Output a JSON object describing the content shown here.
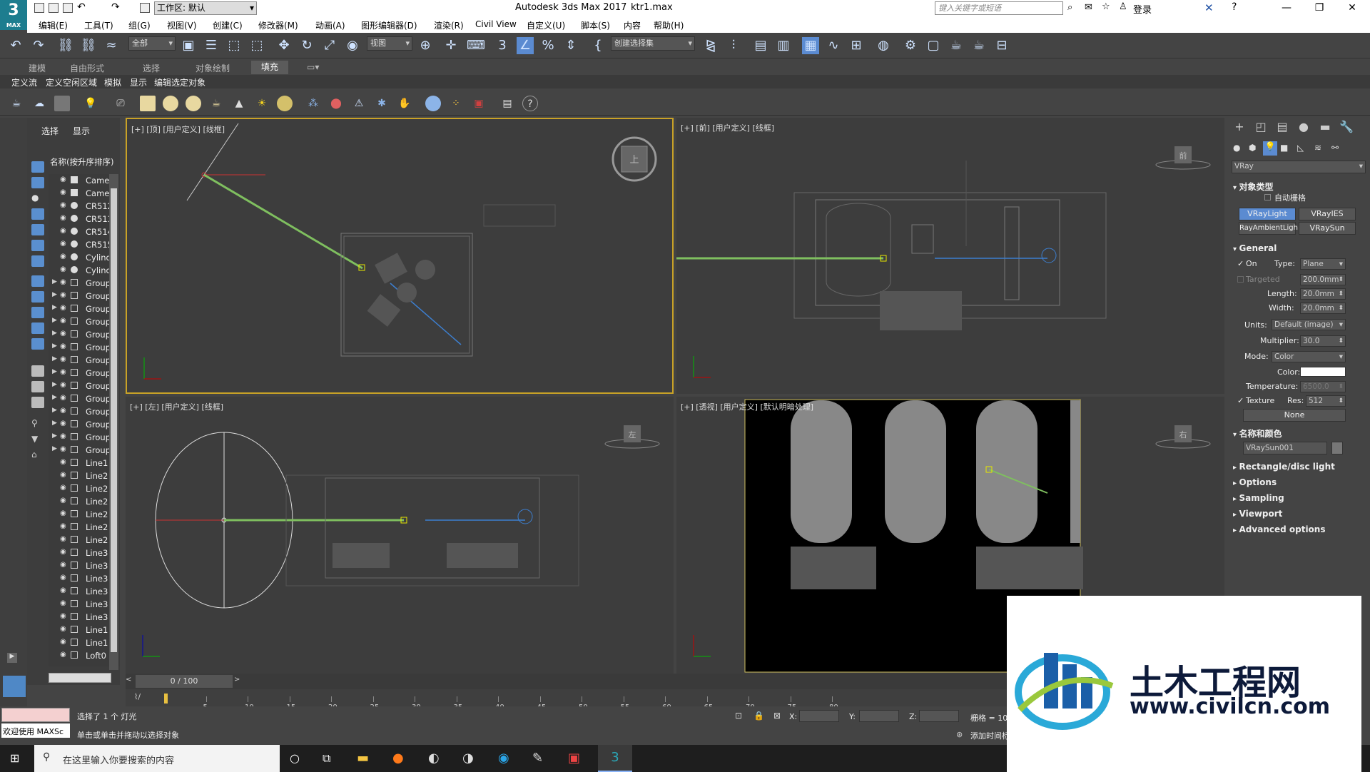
{
  "titlebar": {
    "workspace": "工作区: 默认",
    "app_title": "Autodesk 3ds Max 2017",
    "file_title": "ktr1.max",
    "search_placeholder": "键入关键字或短语",
    "login": "登录",
    "logo_text": "3",
    "logo_sub": "MAX"
  },
  "menubar": {
    "items": [
      "编辑(E)",
      "工具(T)",
      "组(G)",
      "视图(V)",
      "创建(C)",
      "修改器(M)",
      "动画(A)",
      "图形编辑器(D)",
      "渲染(R)",
      "Civil View",
      "自定义(U)",
      "脚本(S)",
      "内容",
      "帮助(H)"
    ]
  },
  "main_toolbar": {
    "filter_dropdown": "全部",
    "ref_coord_dropdown": "视图",
    "selection_set_dropdown": "创建选择集"
  },
  "ribbon": {
    "tabs": [
      "建模",
      "自由形式",
      "选择",
      "对象绘制",
      "填充"
    ],
    "active_tab": "填充",
    "subtabs": [
      "定义流",
      "定义空闲区域",
      "模拟",
      "显示",
      "编辑选定对象"
    ]
  },
  "scene_explorer": {
    "tab_select": "选择",
    "tab_display": "显示",
    "column_header": "名称(按升序排序)",
    "items": [
      "Came",
      "Came",
      "CR512",
      "CR513",
      "CR514",
      "CR515",
      "Cylind",
      "Cylind",
      "Group",
      "Group",
      "Group",
      "Group",
      "Group",
      "Group",
      "Group",
      "Group",
      "Group",
      "Group",
      "Group",
      "Group",
      "Group",
      "Group",
      "Line1",
      "Line2",
      "Line2",
      "Line2",
      "Line2",
      "Line2",
      "Line2",
      "Line3",
      "Line3",
      "Line3",
      "Line3",
      "Line3",
      "Line3",
      "Line1",
      "Line1",
      "Loft0"
    ]
  },
  "viewports": {
    "top": "[+] [顶] [用户定义] [线框]",
    "front": "[+] [前] [用户定义] [线框]",
    "left": "[+] [左] [用户定义] [线框]",
    "persp": "[+] [透视] [用户定义] [默认明暗处理]",
    "cube_top": "上",
    "cube_front": "前",
    "cube_left": "左",
    "cube_right": "右"
  },
  "command_panel": {
    "renderer_dropdown": "VRay",
    "object_type_title": "对象类型",
    "autogrid_label": "自动栅格",
    "buttons": [
      "VRayLight",
      "VRayIES",
      "RayAmbientLigh",
      "VRaySun"
    ],
    "active_button": "VRayLight",
    "general_title": "General",
    "on_label": "On",
    "type_label": "Type:",
    "type_value": "Plane",
    "targeted_label": "Targeted",
    "targeted_value": "200.0mm",
    "length_label": "Length:",
    "length_value": "20.0mm",
    "width_label": "Width:",
    "width_value": "20.0mm",
    "units_label": "Units:",
    "units_value": "Default (image)",
    "multiplier_label": "Multiplier:",
    "multiplier_value": "30.0",
    "mode_label": "Mode:",
    "mode_value": "Color",
    "color_label": "Color:",
    "temperature_label": "Temperature:",
    "temperature_value": "6500.0",
    "texture_label": "Texture",
    "res_label": "Res:",
    "res_value": "512",
    "none_button": "None",
    "name_color_title": "名称和颜色",
    "name_value": "VRaySun001",
    "collapsed": [
      "Rectangle/disc light",
      "Options",
      "Sampling",
      "Viewport",
      "Advanced options"
    ]
  },
  "timeline": {
    "frame_display": "0 / 100",
    "ticks": [
      "5",
      "10",
      "15",
      "20",
      "25",
      "30",
      "35",
      "40",
      "45",
      "50",
      "55",
      "60",
      "65",
      "70",
      "75",
      "80"
    ]
  },
  "status": {
    "maxscript_label": "欢迎使用 MAXSc",
    "selection_status": "选择了 1 个 灯光",
    "prompt": "单击或单击并拖动以选择对象",
    "x_label": "X:",
    "y_label": "Y:",
    "z_label": "Z:",
    "grid_label": "栅格 = 10.",
    "add_time_tag": "添加时间标"
  },
  "taskbar": {
    "search_placeholder": "在这里输入你要搜索的内容"
  },
  "watermark": {
    "name": "土木工程网",
    "url": "www.civilcn.com"
  },
  "colors": {
    "accent_active": "#5b8bd1",
    "viewport_active_border": "#c9a227",
    "viewport_bg": "#3d3d3d",
    "ui_bg": "#444444"
  }
}
